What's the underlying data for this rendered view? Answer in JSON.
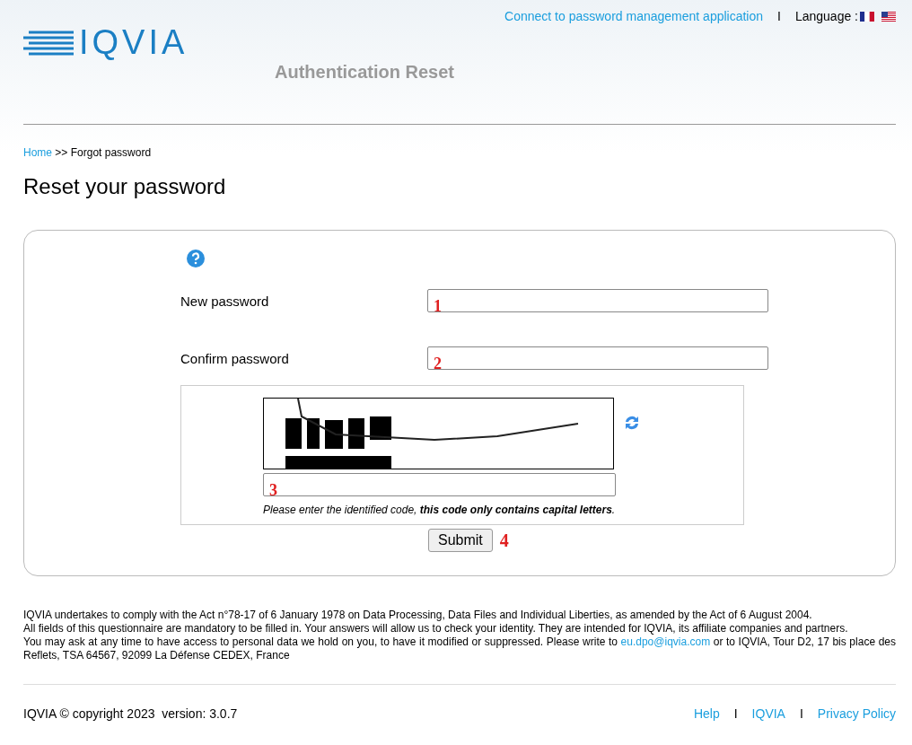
{
  "header": {
    "logo": "IQVIA",
    "title": "Authentication Reset",
    "top_link": "Connect to password management application",
    "separator": "I",
    "language_label": "Language :"
  },
  "breadcrumb": {
    "home": "Home",
    "current": ">> Forgot password"
  },
  "page_title": "Reset your password",
  "form": {
    "fields": [
      {
        "label": "New password",
        "marker": "1"
      },
      {
        "label": "Confirm password",
        "marker": "2"
      }
    ],
    "captcha": {
      "marker": "3",
      "hint": "Please enter the identified code, **this code only contains capital letters**."
    },
    "submit": {
      "label": "Submit",
      "marker": "4"
    }
  },
  "legal": [
    "IQVIA undertakes to comply with the Act n°78-17 of 6 January 1978 on Data Processing, Data Files and Individual Liberties, as amended by the Act of 6 August 2004.",
    "All fields of this questionnaire are mandatory to be filled in. Your answers will allow us to check your identity. They are intended for IQVIA, its affiliate companies and partners."
  ],
  "contact": {
    "before": "You may ask at any time to have access to personal data we hold on you, to have it modified or suppressed. Please write to",
    "email": "eu.dpo@iqvia.com",
    "after": "or to IQVIA, Tour D2, 17 bis place des Reflets, TSA 64567, 92099 La Défense CEDEX, France"
  },
  "footer": {
    "copyright": "IQVIA © copyright 2023  version: 3.0.7",
    "links": [
      "Help",
      "IQVIA",
      "Privacy Policy"
    ],
    "separators": [
      "I",
      "I"
    ]
  }
}
